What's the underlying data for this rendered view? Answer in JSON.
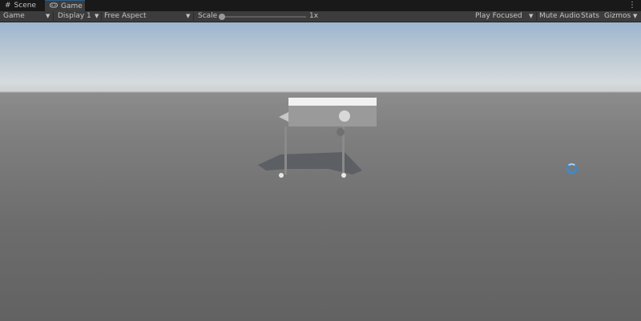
{
  "tabs": [
    {
      "label": "Scene",
      "icon": "scene-grid-icon"
    },
    {
      "label": "Game",
      "icon": "gamepad-icon"
    }
  ],
  "toolbar": {
    "view_mode": "Game",
    "display": "Display 1",
    "aspect": "Free Aspect",
    "scale_label": "Scale",
    "scale_value": "1x",
    "scale_level": 0.0,
    "play_focused": "Play Focused",
    "mute_audio": "Mute Audio",
    "stats": "Stats",
    "gizmos": "Gizmos"
  },
  "colors": {
    "accent": "#2b8fe6",
    "panel": "#3c3c3c",
    "tabbar": "#191919"
  }
}
